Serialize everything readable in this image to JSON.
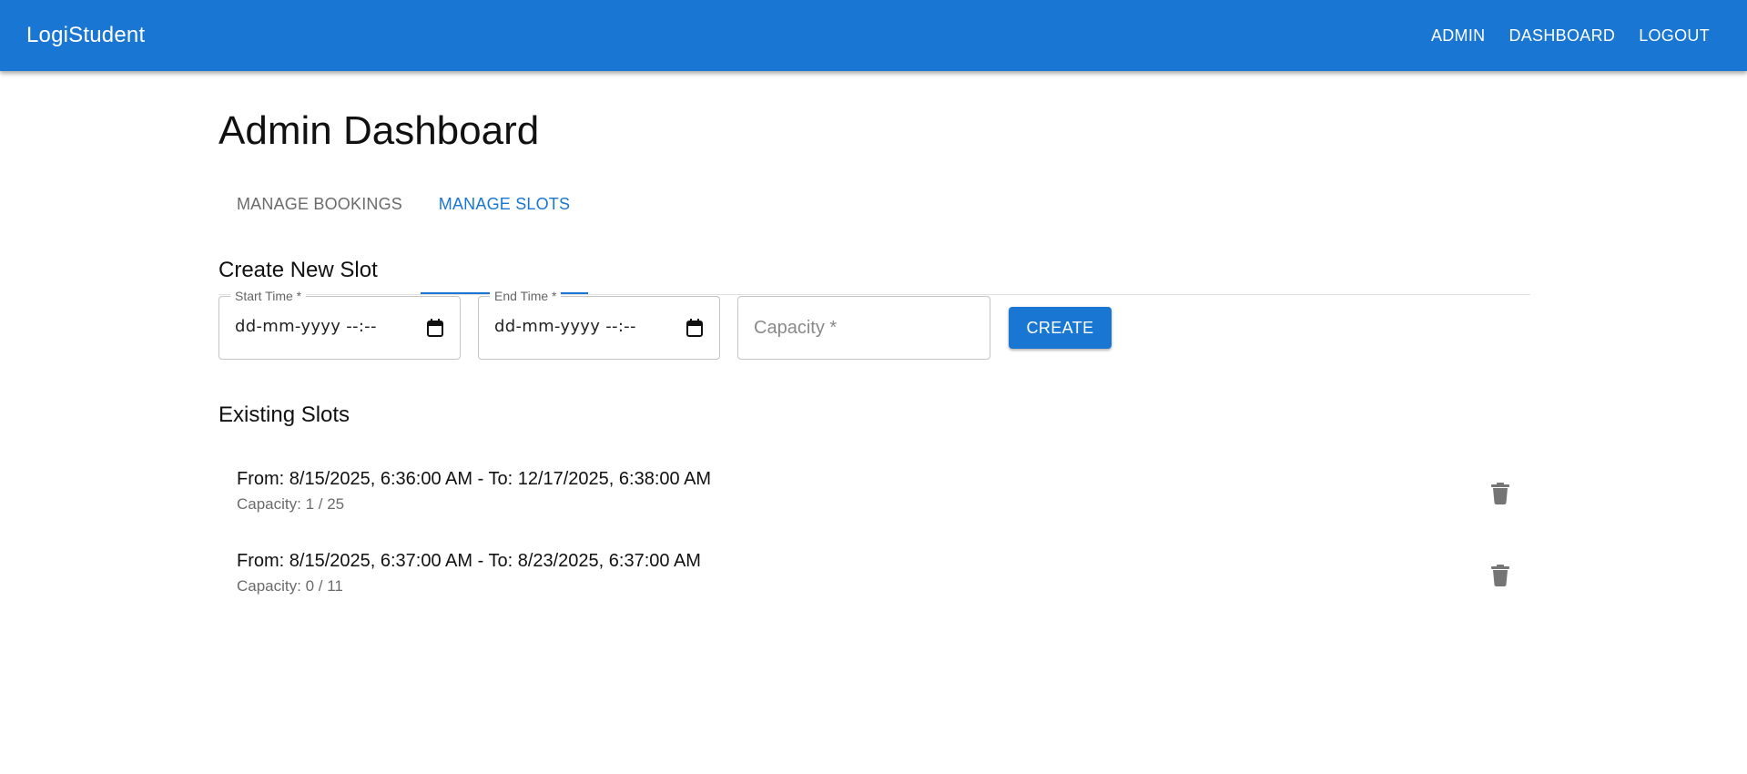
{
  "app": {
    "brand": "LogiStudent"
  },
  "nav": [
    {
      "label": "ADMIN"
    },
    {
      "label": "DASHBOARD"
    },
    {
      "label": "LOGOUT"
    }
  ],
  "page": {
    "title": "Admin Dashboard"
  },
  "tabs": [
    {
      "label": "MANAGE BOOKINGS",
      "selected": false
    },
    {
      "label": "MANAGE SLOTS",
      "selected": true
    }
  ],
  "create_slot": {
    "title": "Create New Slot",
    "start_time": {
      "label": "Start Time *",
      "value": "dd-mm-yyyy --:--",
      "icon": "calendar-icon"
    },
    "end_time": {
      "label": "End Time *",
      "value": "dd-mm-yyyy --:--",
      "icon": "calendar-icon"
    },
    "capacity": {
      "placeholder": "Capacity *",
      "value": ""
    },
    "create_label": "CREATE"
  },
  "existing": {
    "title": "Existing Slots",
    "slots": [
      {
        "primary": "From: 8/15/2025, 6:36:00 AM - To: 12/17/2025, 6:38:00 AM",
        "secondary": "Capacity: 1 / 25",
        "icon": "trash-icon"
      },
      {
        "primary": "From: 8/15/2025, 6:37:00 AM - To: 8/23/2025, 6:37:00 AM",
        "secondary": "Capacity: 0 / 11",
        "icon": "trash-icon"
      }
    ]
  },
  "colors": {
    "primary": "#1976d2",
    "muted": "#6b6b6b",
    "icon": "#757575"
  }
}
